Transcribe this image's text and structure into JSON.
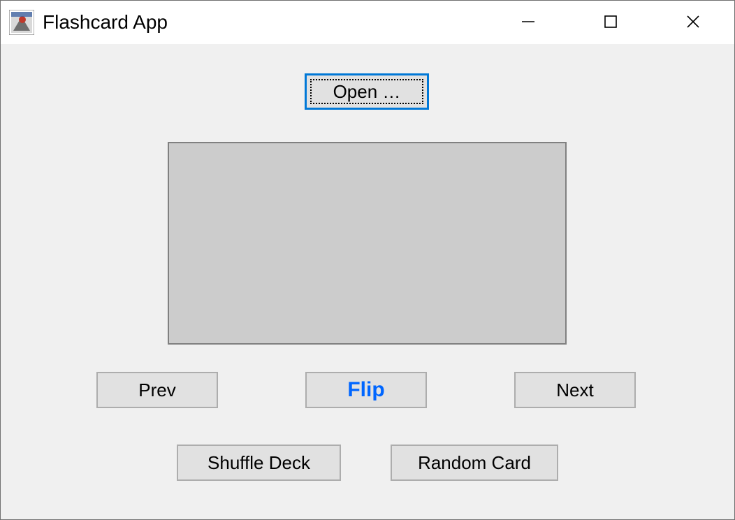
{
  "window": {
    "title": "Flashcard App"
  },
  "buttons": {
    "open": "Open …",
    "prev": "Prev",
    "flip": "Flip",
    "next": "Next",
    "shuffle": "Shuffle Deck",
    "random": "Random Card"
  }
}
